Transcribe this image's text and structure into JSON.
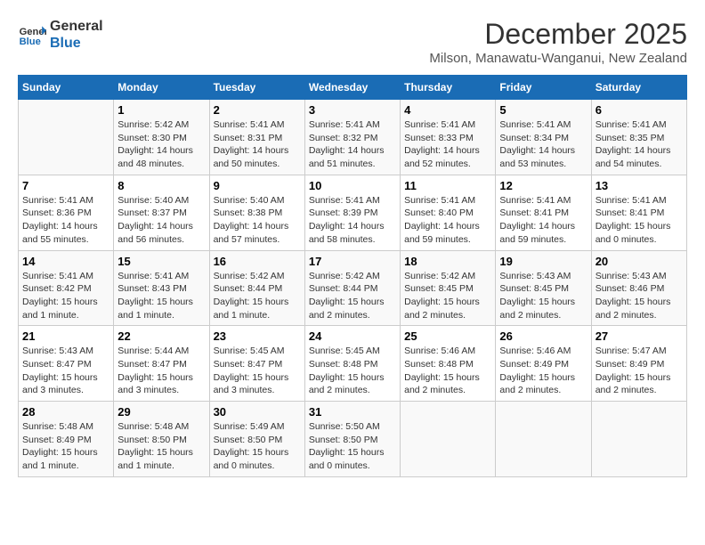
{
  "logo": {
    "line1": "General",
    "line2": "Blue"
  },
  "title": "December 2025",
  "subtitle": "Milson, Manawatu-Wanganui, New Zealand",
  "days_of_week": [
    "Sunday",
    "Monday",
    "Tuesday",
    "Wednesday",
    "Thursday",
    "Friday",
    "Saturday"
  ],
  "weeks": [
    [
      {
        "day": "",
        "info": ""
      },
      {
        "day": "1",
        "info": "Sunrise: 5:42 AM\nSunset: 8:30 PM\nDaylight: 14 hours\nand 48 minutes."
      },
      {
        "day": "2",
        "info": "Sunrise: 5:41 AM\nSunset: 8:31 PM\nDaylight: 14 hours\nand 50 minutes."
      },
      {
        "day": "3",
        "info": "Sunrise: 5:41 AM\nSunset: 8:32 PM\nDaylight: 14 hours\nand 51 minutes."
      },
      {
        "day": "4",
        "info": "Sunrise: 5:41 AM\nSunset: 8:33 PM\nDaylight: 14 hours\nand 52 minutes."
      },
      {
        "day": "5",
        "info": "Sunrise: 5:41 AM\nSunset: 8:34 PM\nDaylight: 14 hours\nand 53 minutes."
      },
      {
        "day": "6",
        "info": "Sunrise: 5:41 AM\nSunset: 8:35 PM\nDaylight: 14 hours\nand 54 minutes."
      }
    ],
    [
      {
        "day": "7",
        "info": "Sunrise: 5:41 AM\nSunset: 8:36 PM\nDaylight: 14 hours\nand 55 minutes."
      },
      {
        "day": "8",
        "info": "Sunrise: 5:40 AM\nSunset: 8:37 PM\nDaylight: 14 hours\nand 56 minutes."
      },
      {
        "day": "9",
        "info": "Sunrise: 5:40 AM\nSunset: 8:38 PM\nDaylight: 14 hours\nand 57 minutes."
      },
      {
        "day": "10",
        "info": "Sunrise: 5:41 AM\nSunset: 8:39 PM\nDaylight: 14 hours\nand 58 minutes."
      },
      {
        "day": "11",
        "info": "Sunrise: 5:41 AM\nSunset: 8:40 PM\nDaylight: 14 hours\nand 59 minutes."
      },
      {
        "day": "12",
        "info": "Sunrise: 5:41 AM\nSunset: 8:41 PM\nDaylight: 14 hours\nand 59 minutes."
      },
      {
        "day": "13",
        "info": "Sunrise: 5:41 AM\nSunset: 8:41 PM\nDaylight: 15 hours\nand 0 minutes."
      }
    ],
    [
      {
        "day": "14",
        "info": "Sunrise: 5:41 AM\nSunset: 8:42 PM\nDaylight: 15 hours\nand 1 minute."
      },
      {
        "day": "15",
        "info": "Sunrise: 5:41 AM\nSunset: 8:43 PM\nDaylight: 15 hours\nand 1 minute."
      },
      {
        "day": "16",
        "info": "Sunrise: 5:42 AM\nSunset: 8:44 PM\nDaylight: 15 hours\nand 1 minute."
      },
      {
        "day": "17",
        "info": "Sunrise: 5:42 AM\nSunset: 8:44 PM\nDaylight: 15 hours\nand 2 minutes."
      },
      {
        "day": "18",
        "info": "Sunrise: 5:42 AM\nSunset: 8:45 PM\nDaylight: 15 hours\nand 2 minutes."
      },
      {
        "day": "19",
        "info": "Sunrise: 5:43 AM\nSunset: 8:45 PM\nDaylight: 15 hours\nand 2 minutes."
      },
      {
        "day": "20",
        "info": "Sunrise: 5:43 AM\nSunset: 8:46 PM\nDaylight: 15 hours\nand 2 minutes."
      }
    ],
    [
      {
        "day": "21",
        "info": "Sunrise: 5:43 AM\nSunset: 8:47 PM\nDaylight: 15 hours\nand 3 minutes."
      },
      {
        "day": "22",
        "info": "Sunrise: 5:44 AM\nSunset: 8:47 PM\nDaylight: 15 hours\nand 3 minutes."
      },
      {
        "day": "23",
        "info": "Sunrise: 5:45 AM\nSunset: 8:47 PM\nDaylight: 15 hours\nand 3 minutes."
      },
      {
        "day": "24",
        "info": "Sunrise: 5:45 AM\nSunset: 8:48 PM\nDaylight: 15 hours\nand 2 minutes."
      },
      {
        "day": "25",
        "info": "Sunrise: 5:46 AM\nSunset: 8:48 PM\nDaylight: 15 hours\nand 2 minutes."
      },
      {
        "day": "26",
        "info": "Sunrise: 5:46 AM\nSunset: 8:49 PM\nDaylight: 15 hours\nand 2 minutes."
      },
      {
        "day": "27",
        "info": "Sunrise: 5:47 AM\nSunset: 8:49 PM\nDaylight: 15 hours\nand 2 minutes."
      }
    ],
    [
      {
        "day": "28",
        "info": "Sunrise: 5:48 AM\nSunset: 8:49 PM\nDaylight: 15 hours\nand 1 minute."
      },
      {
        "day": "29",
        "info": "Sunrise: 5:48 AM\nSunset: 8:50 PM\nDaylight: 15 hours\nand 1 minute."
      },
      {
        "day": "30",
        "info": "Sunrise: 5:49 AM\nSunset: 8:50 PM\nDaylight: 15 hours\nand 0 minutes."
      },
      {
        "day": "31",
        "info": "Sunrise: 5:50 AM\nSunset: 8:50 PM\nDaylight: 15 hours\nand 0 minutes."
      },
      {
        "day": "",
        "info": ""
      },
      {
        "day": "",
        "info": ""
      },
      {
        "day": "",
        "info": ""
      }
    ]
  ]
}
